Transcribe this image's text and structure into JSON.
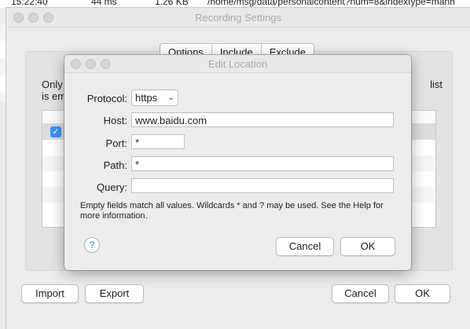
{
  "background": {
    "log_time": "15:22:40",
    "log_duration": "44 ms",
    "log_size": "1.26 KB",
    "log_path": "/home/msg/data/personalcontent?num=8&indextype=manh"
  },
  "recording_window": {
    "title": "Recording Settings",
    "tabs": [
      "Options",
      "Include",
      "Exclude"
    ],
    "desc_left_1": "Only",
    "desc_left_2": "is em",
    "desc_right": "list",
    "import_label": "Import",
    "export_label": "Export",
    "cancel_label": "Cancel",
    "ok_label": "OK"
  },
  "edit_location": {
    "title": "Edit Location",
    "protocol_label": "Protocol:",
    "protocol_value": "https",
    "host_label": "Host:",
    "host_value": "www.baidu.com",
    "port_label": "Port:",
    "port_value": "*",
    "path_label": "Path:",
    "path_value": "*",
    "query_label": "Query:",
    "query_value": "",
    "hint": "Empty fields match all values. Wildcards * and ? may be used. See the Help for more information.",
    "help_glyph": "?",
    "cancel_label": "Cancel",
    "ok_label": "OK"
  },
  "colors": {
    "accent": "#3f8ff7",
    "window_bg": "#ececec"
  },
  "icons": {
    "checkbox": "check-icon",
    "help": "help-icon",
    "dropdown": "chevron-updown-icon"
  }
}
